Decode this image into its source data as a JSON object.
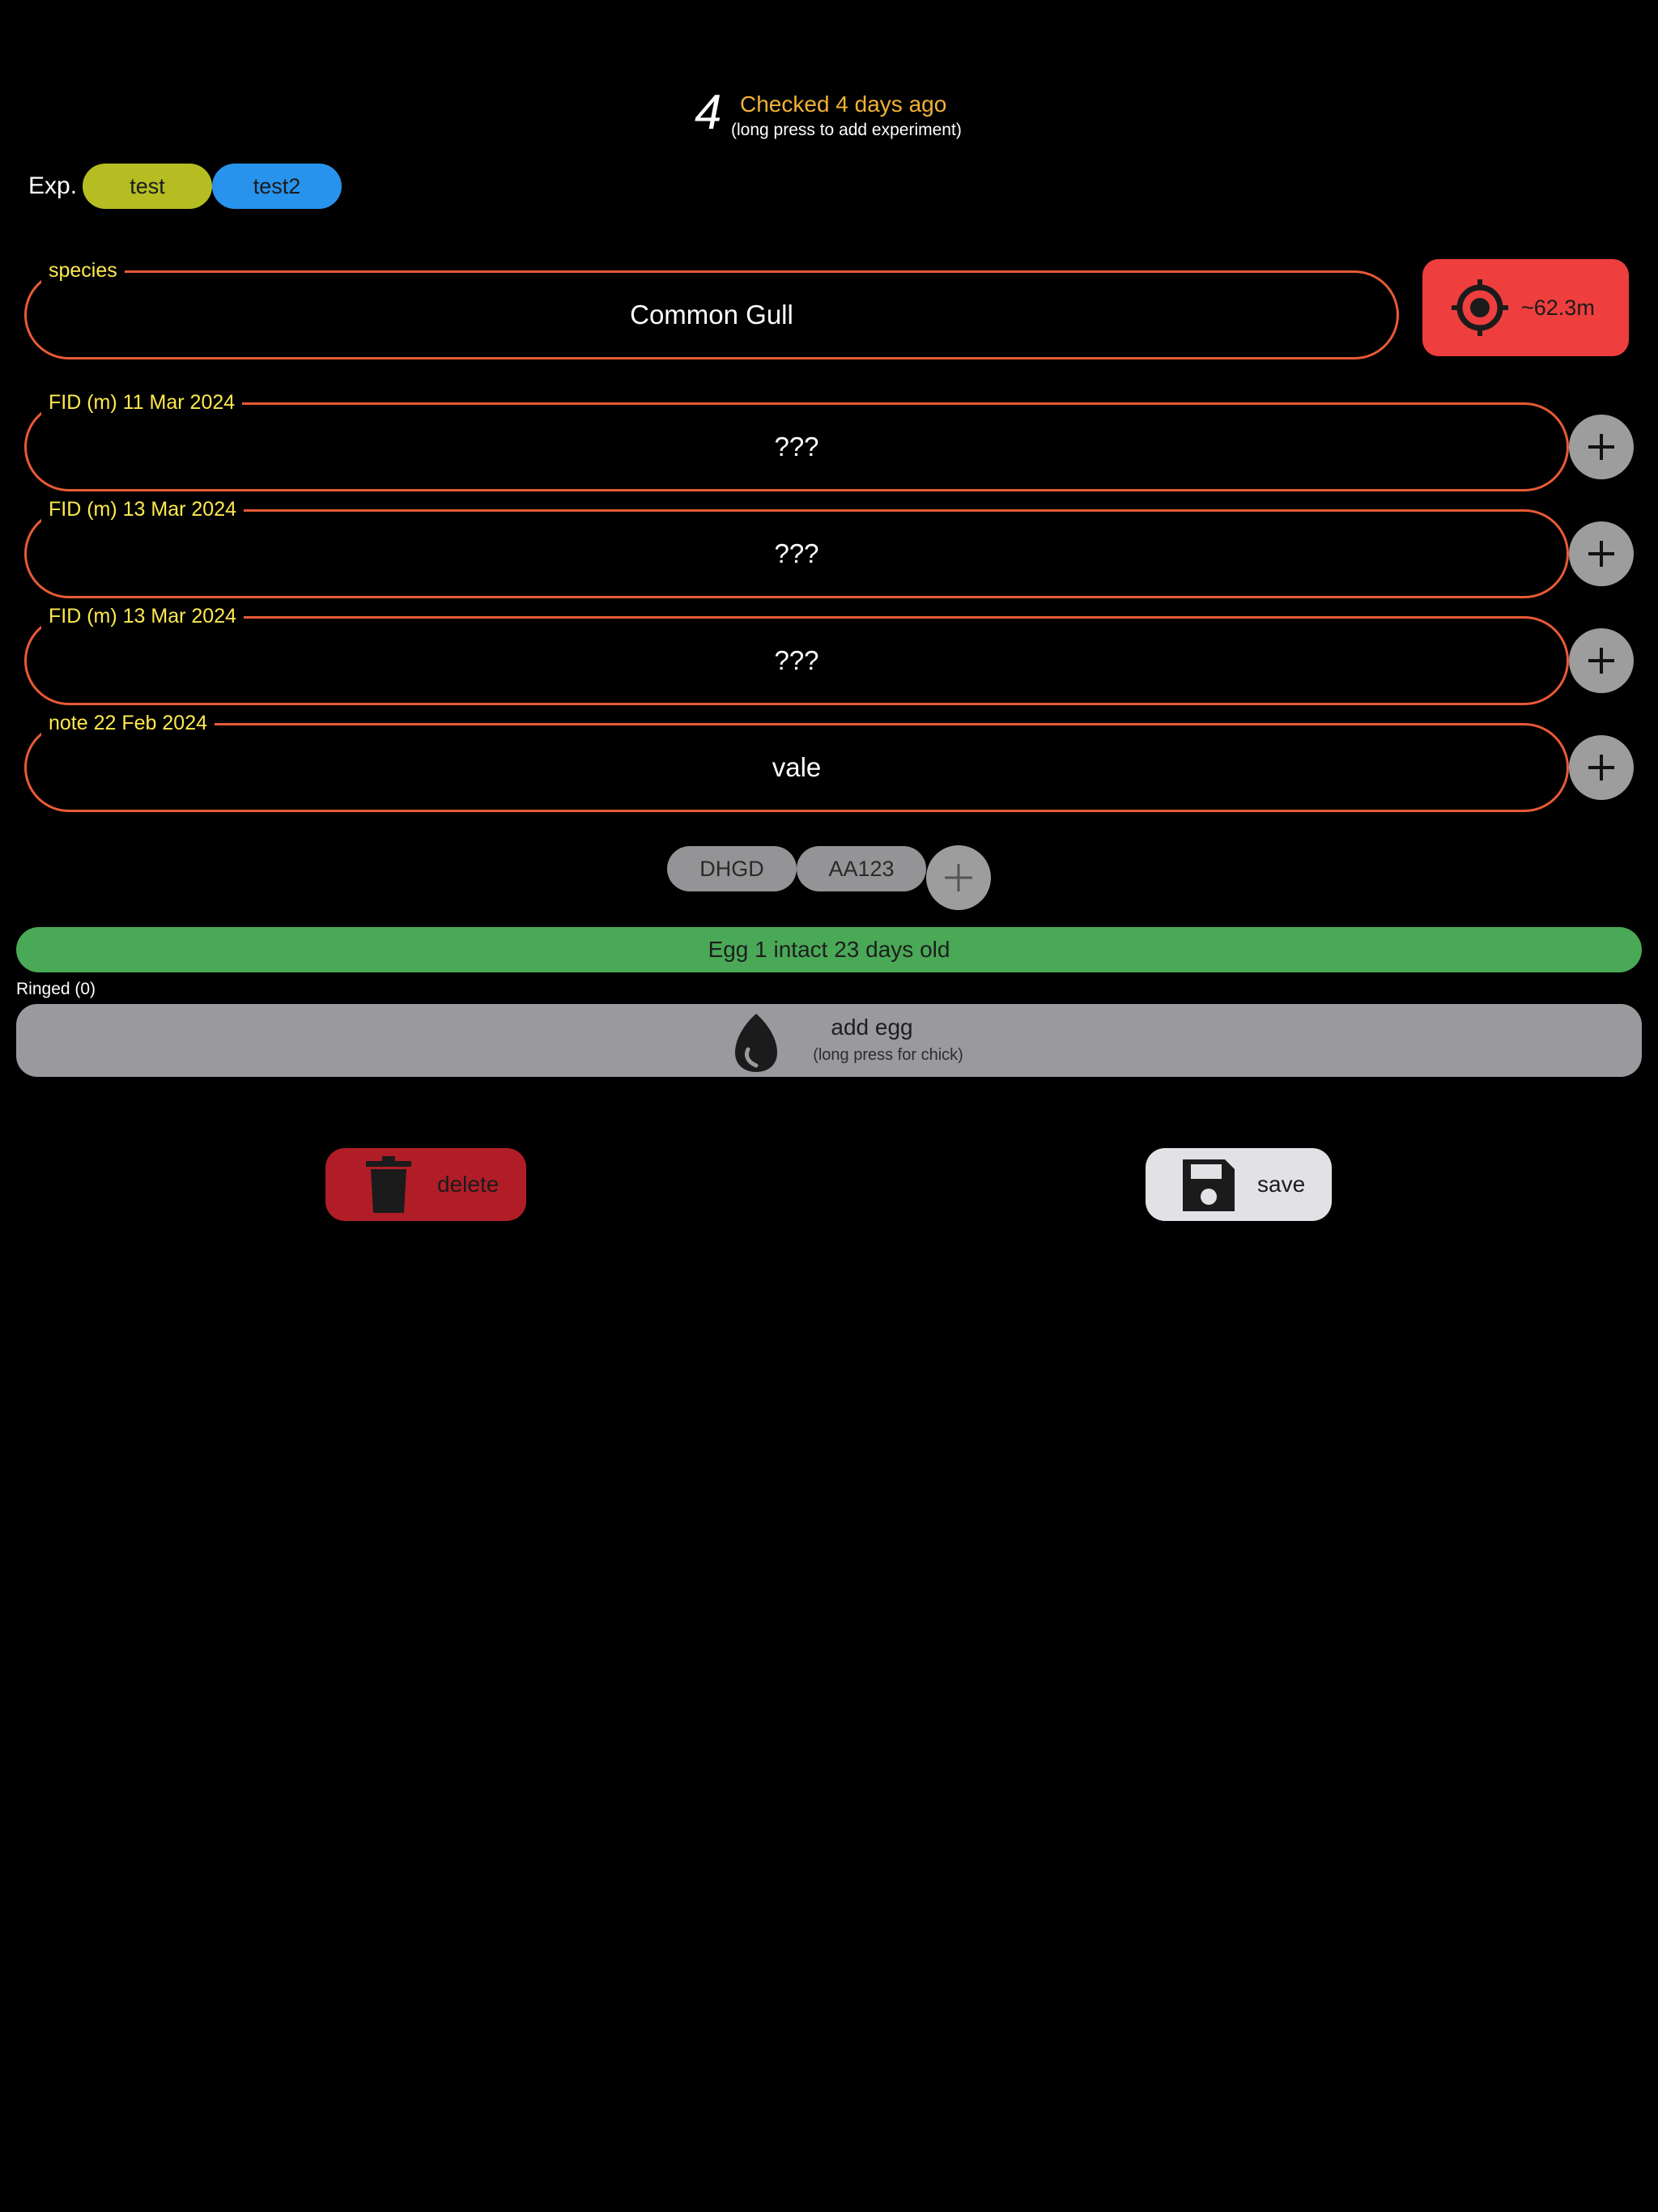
{
  "header": {
    "nest_number": "4",
    "checked": "Checked 4 days ago",
    "hint": "(long press to add experiment)"
  },
  "experiments": {
    "label": "Exp.",
    "chips": [
      {
        "label": "test",
        "color": "#b5bd22"
      },
      {
        "label": "test2",
        "color": "#2893ec"
      }
    ]
  },
  "species": {
    "label": "species",
    "value": "Common Gull"
  },
  "location": {
    "label": "~62.3m",
    "icon": "gps-crosshair-icon",
    "color": "#ee3e3e"
  },
  "measures": [
    {
      "label": "FID (m) 11 Mar 2024",
      "value": "???"
    },
    {
      "label": "FID (m) 13 Mar 2024",
      "value": "???"
    },
    {
      "label": "FID (m) 13 Mar 2024",
      "value": "???"
    },
    {
      "label": "note 22 Feb 2024",
      "value": "vale"
    }
  ],
  "rings": {
    "chips": [
      "DHGD",
      "AA123"
    ]
  },
  "eggs": {
    "items": [
      "Egg 1 intact 23 days old"
    ],
    "item_color": "#4aa957",
    "ringed": "Ringed (0)",
    "add_label": "add egg",
    "add_sub": "(long press for chick)"
  },
  "actions": {
    "delete": "delete",
    "save": "save",
    "delete_color": "#b11d27",
    "save_color": "#e2e2e6"
  },
  "colors": {
    "field_border": "#e85a35",
    "field_label": "#ffe94d",
    "checked_text": "#f2b233"
  }
}
